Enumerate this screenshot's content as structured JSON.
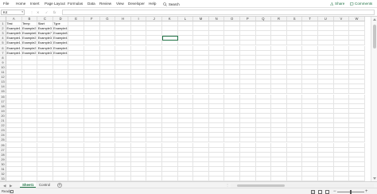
{
  "menu": {
    "items": [
      "File",
      "Home",
      "Insert",
      "Page Layout",
      "Formulas",
      "Data",
      "Review",
      "View",
      "Developer",
      "Help"
    ],
    "search_label": "Search",
    "share_label": "Share",
    "comments_label": "Comments"
  },
  "formula_bar": {
    "name_box": "K4",
    "cancel_glyph": "✕",
    "enter_glyph": "✓",
    "fx_label": "fx",
    "value": ""
  },
  "grid": {
    "columns": [
      "A",
      "B",
      "C",
      "D",
      "E",
      "F",
      "G",
      "H",
      "I",
      "J",
      "K",
      "L",
      "M",
      "N",
      "O",
      "P",
      "Q",
      "R",
      "S",
      "T",
      "U",
      "V",
      "W"
    ],
    "rows": [
      "1",
      "2",
      "3",
      "4",
      "5",
      "6",
      "7",
      "8",
      "9",
      "10",
      "11",
      "12",
      "13",
      "14",
      "15",
      "16",
      "17",
      "18",
      "19",
      "20",
      "21",
      "22",
      "23",
      "24",
      "25",
      "26",
      "27",
      "28",
      "29",
      "30",
      "31",
      "32",
      "33",
      "34"
    ],
    "cells": [
      [
        "Test",
        "Temp",
        "Start",
        "Type"
      ],
      [
        "Example1",
        "Example2",
        "Example3",
        "Example4"
      ],
      [
        "Example5",
        "Example6",
        "Example7",
        "Example8"
      ],
      [
        "Example1",
        "Example2",
        "Example3",
        "Example4"
      ],
      [
        "Example1",
        "Example2",
        "Example3",
        "Example4"
      ],
      [
        "Example1",
        "Example2",
        "Example3",
        "Example4"
      ],
      [
        "Example1",
        "Example2",
        "Example3",
        "Example4"
      ]
    ]
  },
  "sheets": {
    "tabs": [
      "Sheet1",
      "Control"
    ],
    "add_label": "+"
  },
  "status": {
    "text": "Ready",
    "zoom_minus": "−",
    "zoom_plus": "+",
    "zoom": ""
  },
  "colors": {
    "accent": "#217346",
    "header_bg": "#f3f3f3",
    "gridline": "#e4e4e4"
  }
}
